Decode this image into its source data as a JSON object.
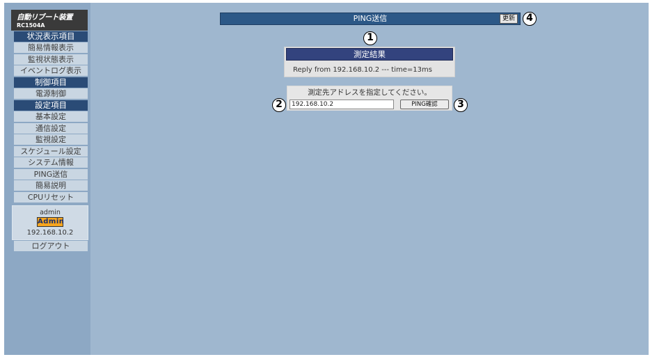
{
  "sidebar": {
    "brand_title": "自動リブート装置",
    "brand_model": "RC1504A",
    "sections": [
      {
        "heading": "状況表示項目",
        "items": [
          "簡易情報表示",
          "監視状態表示",
          "イベントログ表示"
        ]
      },
      {
        "heading": "制御項目",
        "items": [
          "電源制御"
        ]
      },
      {
        "heading": "設定項目",
        "items": [
          "基本設定",
          "通信設定",
          "監視設定",
          "スケジュール設定",
          "システム情報",
          "PING送信",
          "簡易説明",
          "CPUリセット"
        ]
      }
    ],
    "user": {
      "name": "admin",
      "role_badge": "Admin",
      "ip": "192.168.10.2"
    },
    "logout_label": "ログアウト"
  },
  "main": {
    "page_title": "PING送信",
    "refresh_label": "更新",
    "result_heading": "測定結果",
    "result_text": "Reply from 192.168.10.2 --- time=13ms",
    "address_prompt": "測定先アドレスを指定してください。",
    "address_value": "192.168.10.2",
    "ping_button_label": "PING確認",
    "callouts": [
      "1",
      "2",
      "3",
      "4"
    ]
  },
  "colors": {
    "sidebar_bg": "#8da8c4",
    "main_bg": "#9fb7cf",
    "section_heading": "#2a4b76",
    "title_bar": "#2c5887",
    "result_heading": "#33437e",
    "badge": "#f7a51d"
  }
}
